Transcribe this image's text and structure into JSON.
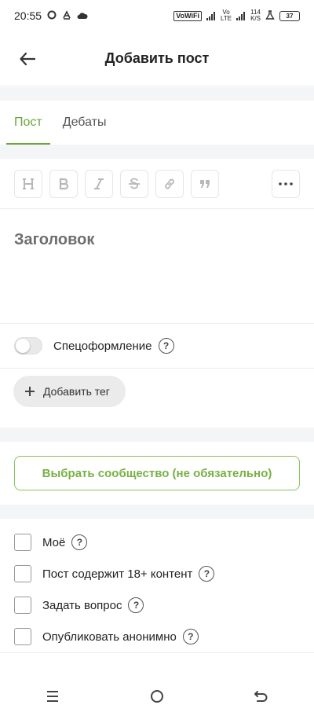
{
  "status_bar": {
    "time": "20:55",
    "vowifi": "VoWiFi",
    "volte_top": "Vo",
    "volte_bottom": "LTE",
    "speed_top": "114",
    "speed_bottom": "K/S",
    "battery": "37"
  },
  "header": {
    "title": "Добавить пост"
  },
  "tabs": [
    {
      "label": "Пост",
      "active": true
    },
    {
      "label": "Дебаты",
      "active": false
    }
  ],
  "toolbar": {
    "tools": [
      "heading-icon",
      "bold-icon",
      "italic-icon",
      "strikethrough-icon",
      "link-icon",
      "quote-icon",
      "more-icon"
    ]
  },
  "editor": {
    "title_placeholder": "Заголовок"
  },
  "special_format": {
    "label": "Спецоформление",
    "enabled": false
  },
  "add_tag": {
    "label": "Добавить тег"
  },
  "community": {
    "label": "Выбрать сообщество (не обязательно)"
  },
  "options": [
    {
      "label": "Моё",
      "checked": false
    },
    {
      "label": "Пост содержит 18+ контент",
      "checked": false
    },
    {
      "label": "Задать вопрос",
      "checked": false
    },
    {
      "label": "Опубликовать анонимно",
      "checked": false
    }
  ],
  "help_symbol": "?",
  "colors": {
    "accent": "#6ba53a",
    "button_border": "#8bc15b",
    "background_strip": "#f4f5f7"
  }
}
